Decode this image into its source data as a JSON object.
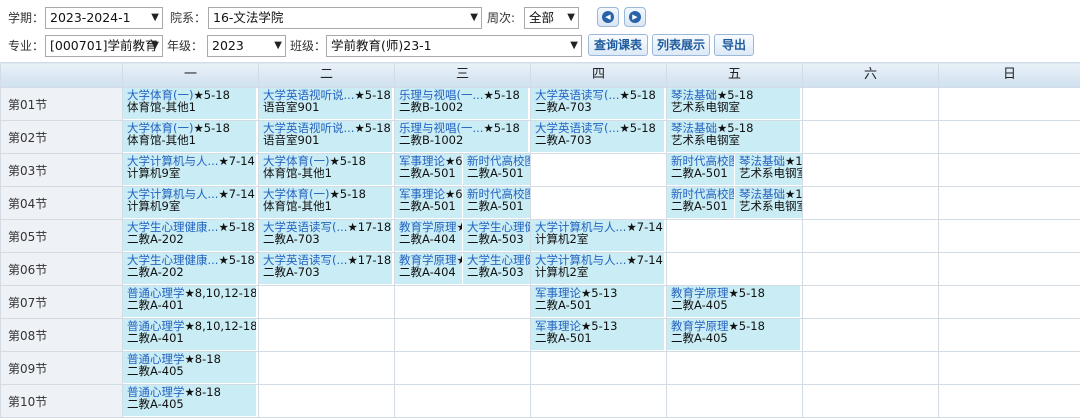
{
  "filters": {
    "term_label": "学期：",
    "term_value": "2023-2024-1",
    "dept_label": "院系：",
    "dept_value": "16-文法学院",
    "week_label": "周次:",
    "week_value": "全部",
    "major_label": "专业：",
    "major_value": "[000701]学前教育",
    "grade_label": "年级：",
    "grade_value": "2023",
    "class_label": "班级：",
    "class_value": "学前教育(师)23-1",
    "prev_icon": "arrow-left-icon",
    "next_icon": "arrow-right-icon",
    "query_button": "查询课表",
    "list_button": "列表展示",
    "export_button": "导出"
  },
  "days": [
    "一",
    "二",
    "三",
    "四",
    "五",
    "六",
    "日"
  ],
  "colors": {
    "course_bg": "#c9ecf5",
    "course_link": "#2563c0",
    "header_bg": "#d6e5f2"
  },
  "rows": [
    {
      "slot": "第01节",
      "cells": [
        [
          {
            "name": "大学体育(一)",
            "weeks": "★5-18",
            "room": "体育馆-其他1"
          }
        ],
        [
          {
            "name": "大学英语视听说...",
            "weeks": "★5-18",
            "room": "语音室901"
          }
        ],
        [
          {
            "name": "乐理与视唱(一...",
            "weeks": "★5-18",
            "room": "二教B-1002"
          }
        ],
        [
          {
            "name": "大学英语读写(...",
            "weeks": "★5-18",
            "room": "二教A-703"
          }
        ],
        [
          {
            "name": "琴法基础",
            "weeks": "★5-18",
            "room": "艺术系电钢室"
          }
        ],
        [],
        []
      ]
    },
    {
      "slot": "第02节",
      "cells": [
        [
          {
            "name": "大学体育(一)",
            "weeks": "★5-18",
            "room": "体育馆-其他1"
          }
        ],
        [
          {
            "name": "大学英语视听说...",
            "weeks": "★5-18",
            "room": "语音室901"
          }
        ],
        [
          {
            "name": "乐理与视唱(一...",
            "weeks": "★5-18",
            "room": "二教B-1002"
          }
        ],
        [
          {
            "name": "大学英语读写(...",
            "weeks": "★5-18",
            "room": "二教A-703"
          }
        ],
        [
          {
            "name": "琴法基础",
            "weeks": "★5-18",
            "room": "艺术系电钢室"
          }
        ],
        [],
        []
      ]
    },
    {
      "slot": "第03节",
      "cells": [
        [
          {
            "name": "大学计算机与人...",
            "weeks": "★7-14",
            "room": "计算机9室"
          }
        ],
        [
          {
            "name": "大学体育(一)",
            "weeks": "★5-18",
            "room": "体育馆-其他1"
          }
        ],
        [
          {
            "name": "军事理论",
            "weeks": "★6",
            "room": "二教A-501"
          },
          {
            "name": "新时代高校图",
            "weeks": "",
            "room": "二教A-501"
          }
        ],
        [],
        [
          {
            "name": "新时代高校图",
            "weeks": "",
            "room": "二教A-501"
          },
          {
            "name": "琴法基础",
            "weeks": "★1",
            "room": "艺术系电钢室"
          }
        ],
        [],
        []
      ]
    },
    {
      "slot": "第04节",
      "cells": [
        [
          {
            "name": "大学计算机与人...",
            "weeks": "★7-14",
            "room": "计算机9室"
          }
        ],
        [
          {
            "name": "大学体育(一)",
            "weeks": "★5-18",
            "room": "体育馆-其他1"
          }
        ],
        [
          {
            "name": "军事理论",
            "weeks": "★6",
            "room": "二教A-501"
          },
          {
            "name": "新时代高校图",
            "weeks": "",
            "room": "二教A-501"
          }
        ],
        [],
        [
          {
            "name": "新时代高校图",
            "weeks": "",
            "room": "二教A-501"
          },
          {
            "name": "琴法基础",
            "weeks": "★1",
            "room": "艺术系电钢室"
          }
        ],
        [],
        []
      ]
    },
    {
      "slot": "第05节",
      "cells": [
        [
          {
            "name": "大学生心理健康...",
            "weeks": "★5-18",
            "room": "二教A-202"
          }
        ],
        [
          {
            "name": "大学英语读写(...",
            "weeks": "★17-18",
            "room": "二教A-703"
          }
        ],
        [
          {
            "name": "教育学原理",
            "weeks": "★",
            "room": "二教A-404"
          },
          {
            "name": "大学生心理健",
            "weeks": "",
            "room": "二教A-503"
          }
        ],
        [
          {
            "name": "大学计算机与人...",
            "weeks": "★7-14",
            "room": "计算机2室"
          }
        ],
        [],
        [],
        []
      ]
    },
    {
      "slot": "第06节",
      "cells": [
        [
          {
            "name": "大学生心理健康...",
            "weeks": "★5-18",
            "room": "二教A-202"
          }
        ],
        [
          {
            "name": "大学英语读写(...",
            "weeks": "★17-18",
            "room": "二教A-703"
          }
        ],
        [
          {
            "name": "教育学原理",
            "weeks": "★",
            "room": "二教A-404"
          },
          {
            "name": "大学生心理健",
            "weeks": "",
            "room": "二教A-503"
          }
        ],
        [
          {
            "name": "大学计算机与人...",
            "weeks": "★7-14",
            "room": "计算机2室"
          }
        ],
        [],
        [],
        []
      ]
    },
    {
      "slot": "第07节",
      "cells": [
        [
          {
            "name": "普通心理学",
            "weeks": "★8,10,12-18",
            "room": "二教A-401"
          }
        ],
        [],
        [],
        [
          {
            "name": "军事理论",
            "weeks": "★5-13",
            "room": "二教A-501"
          }
        ],
        [
          {
            "name": "教育学原理",
            "weeks": "★5-18",
            "room": "二教A-405"
          }
        ],
        [],
        []
      ]
    },
    {
      "slot": "第08节",
      "cells": [
        [
          {
            "name": "普通心理学",
            "weeks": "★8,10,12-18",
            "room": "二教A-401"
          }
        ],
        [],
        [],
        [
          {
            "name": "军事理论",
            "weeks": "★5-13",
            "room": "二教A-501"
          }
        ],
        [
          {
            "name": "教育学原理",
            "weeks": "★5-18",
            "room": "二教A-405"
          }
        ],
        [],
        []
      ]
    },
    {
      "slot": "第09节",
      "cells": [
        [
          {
            "name": "普通心理学",
            "weeks": "★8-18",
            "room": "二教A-405"
          }
        ],
        [],
        [],
        [],
        [],
        [],
        []
      ]
    },
    {
      "slot": "第10节",
      "cells": [
        [
          {
            "name": "普通心理学",
            "weeks": "★8-18",
            "room": "二教A-405"
          }
        ],
        [],
        [],
        [],
        [],
        [],
        []
      ]
    }
  ]
}
